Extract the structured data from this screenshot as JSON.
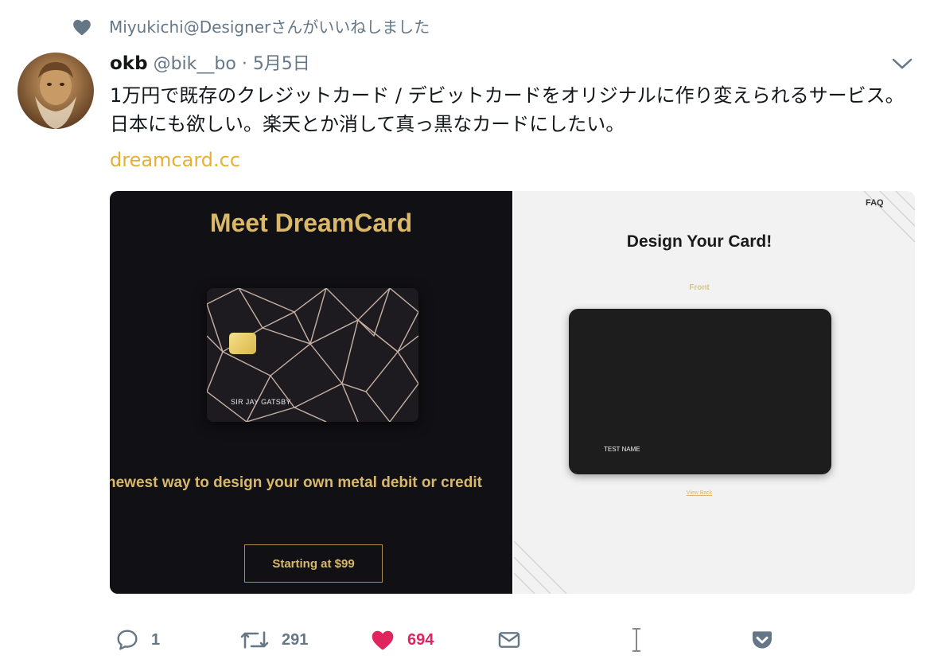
{
  "context": {
    "text": "Miyukichi@Designerさんがいいねしました"
  },
  "tweet": {
    "name": "okb",
    "handle": "@bik__bo",
    "separator": "·",
    "date": "5月5日",
    "text": "1万円で既存のクレジットカード / デビットカードをオリジナルに作り変えられるサービス。日本にも欲しい。楽天とか消して真っ黒なカードにしたい。",
    "link": "dreamcard.cc"
  },
  "media": {
    "left": {
      "title": "Meet DreamCard",
      "card_name": "SIR JAY GATSBY",
      "tagline": "newest way to design your own metal debit or credit",
      "button": "Starting at $99"
    },
    "right": {
      "nav": "FAQ",
      "title": "Design Your Card!",
      "side_label": "Front",
      "card_name": "TEST NAME",
      "view_back": "View Back"
    }
  },
  "actions": {
    "reply_count": "1",
    "retweet_count": "291",
    "like_count": "694"
  },
  "colors": {
    "like": "#e0245e",
    "link": "#e7b033",
    "muted": "#657786",
    "gold": "#d9b86a"
  }
}
